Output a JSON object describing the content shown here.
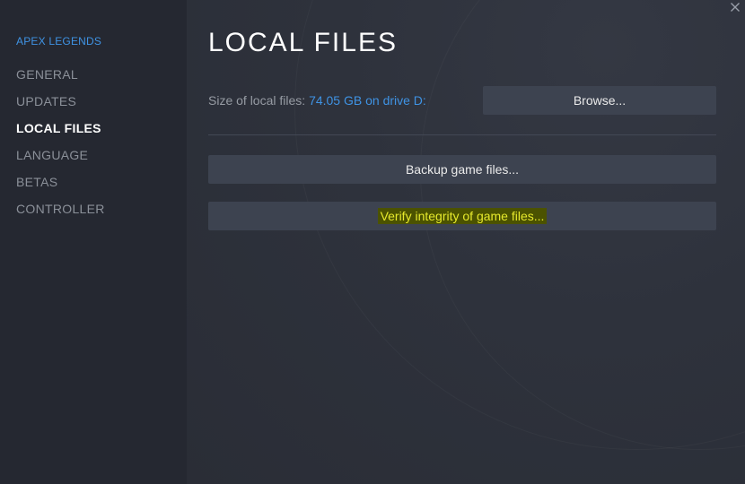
{
  "window": {
    "close_symbol": "✕"
  },
  "sidebar": {
    "game_title": "APEX LEGENDS",
    "items": [
      {
        "label": "GENERAL",
        "active": false
      },
      {
        "label": "UPDATES",
        "active": false
      },
      {
        "label": "LOCAL FILES",
        "active": true
      },
      {
        "label": "LANGUAGE",
        "active": false
      },
      {
        "label": "BETAS",
        "active": false
      },
      {
        "label": "CONTROLLER",
        "active": false
      }
    ]
  },
  "main": {
    "title": "LOCAL FILES",
    "size_label": "Size of local files:",
    "size_value": "74.05 GB on drive D:",
    "browse_label": "Browse...",
    "backup_label": "Backup game files...",
    "verify_label": "Verify integrity of game files..."
  },
  "colors": {
    "accent": "#3f93e4",
    "highlight_text": "#e6e92c",
    "highlight_bg": "#4b5200"
  },
  "icons": {
    "close": "close-icon"
  }
}
